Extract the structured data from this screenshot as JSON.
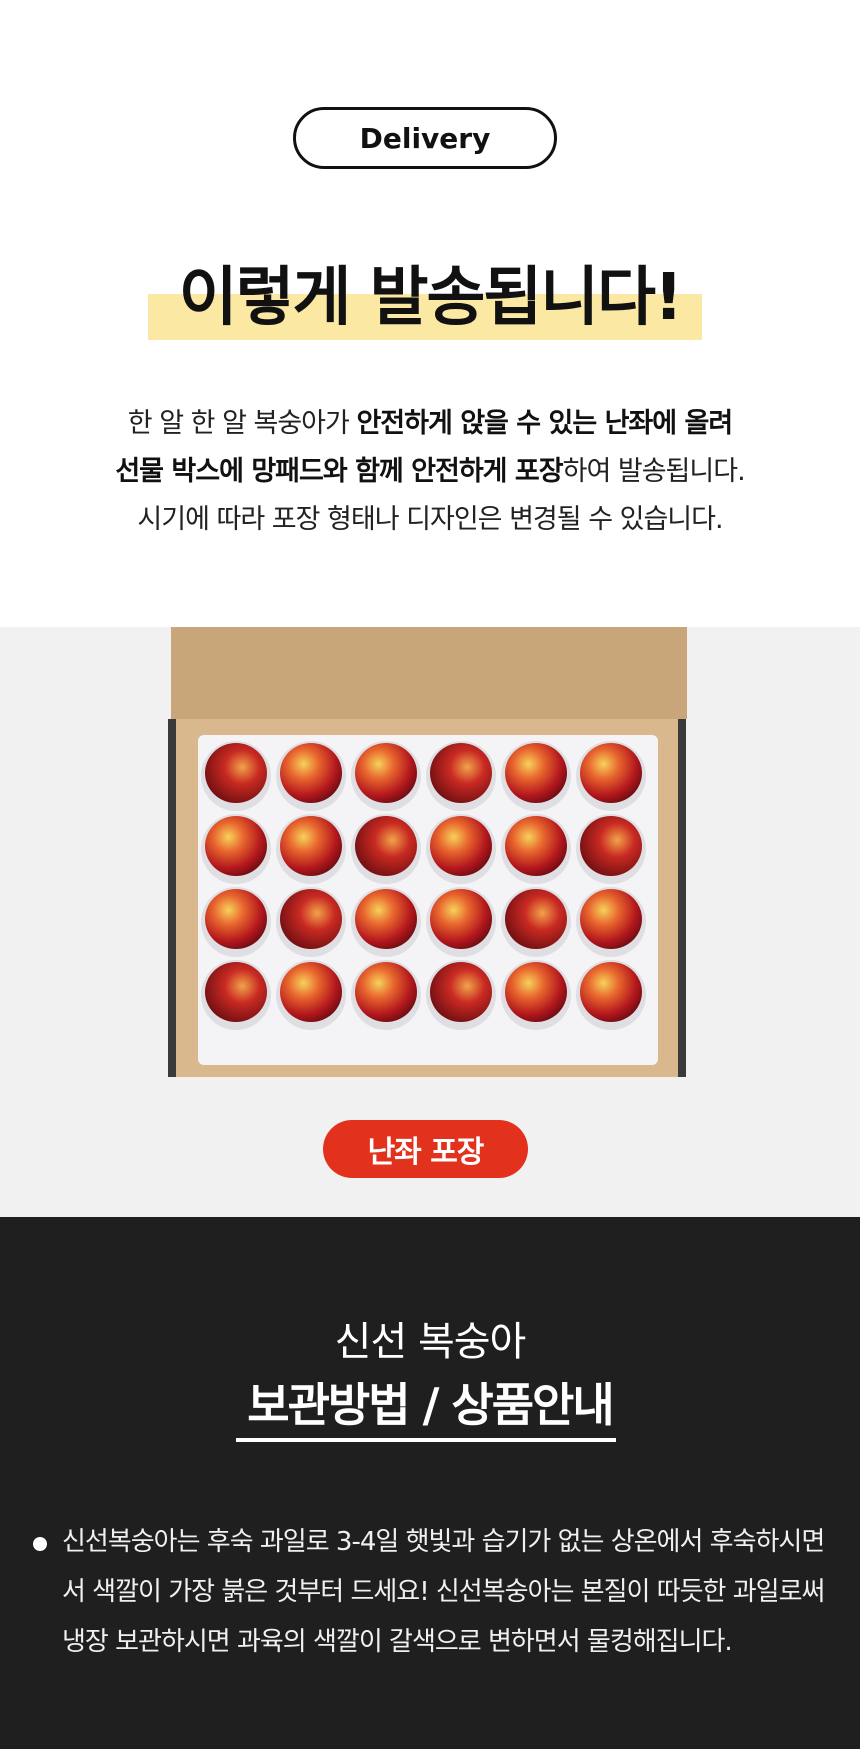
{
  "header": {
    "pill_label": "Delivery",
    "headline": "이렇게 발송됩니다!",
    "highlight_color": "#fbe9a3"
  },
  "intro": {
    "line1_plain": "한 알 한 알 복숭아가 ",
    "line1_bold": "안전하게 앉을 수 있는 난좌에 올려",
    "line2_bold": "선물 박스에 망패드와 함께 안전하게 포장",
    "line2_plain": "하여 발송됩니다.",
    "line3": "시기에 따라 포장 형태나 디자인은 변경될 수 있습니다."
  },
  "photo": {
    "badge_label": "난좌 포장",
    "badge_color": "#e2311d",
    "description_icon": "peach-box-photo"
  },
  "storage": {
    "subtitle": "신선 복숭아",
    "title": "보관방법 / 상품안내",
    "bullets": [
      "신선복숭아는 후숙 과일로 3-4일 햇빛과 습기가 없는 상온에서 후숙하시면서 색깔이 가장 붉은 것부터 드세요! 신선복숭아는 본질이 따듯한 과일로써 냉장 보관하시면 과육의 색깔이 갈색으로 변하면서 물컹해집니다."
    ]
  }
}
